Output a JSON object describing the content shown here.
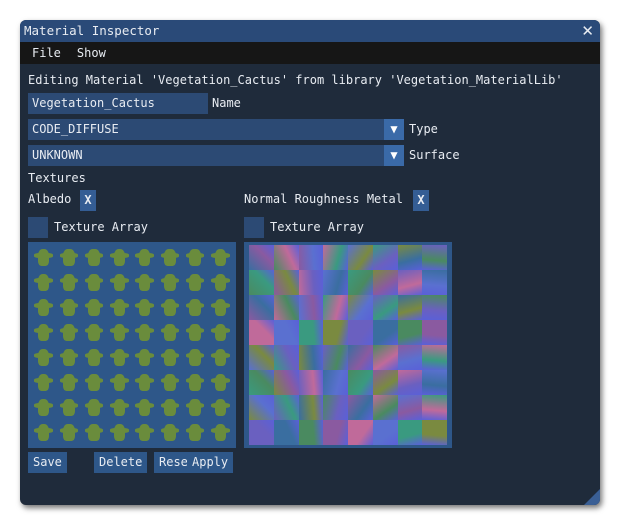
{
  "window": {
    "title": "Material Inspector"
  },
  "menu": [
    "File",
    "Show"
  ],
  "editing_text": "Editing Material 'Vegetation_Cactus' from library 'Vegetation_MaterialLib'",
  "name": {
    "value": "Vegetation_Cactus",
    "label": "Name"
  },
  "type": {
    "value": "CODE_DIFFUSE",
    "label": "Type"
  },
  "surface": {
    "value": "UNKNOWN",
    "label": "Surface"
  },
  "textures": {
    "heading": "Textures",
    "albedo_label": "Albedo",
    "normal_label": "Normal Roughness Metal",
    "clear_label": "X",
    "texture_array_label": "Texture Array"
  },
  "buttons": {
    "save": "Save",
    "delete": "Delete",
    "reset": "Reset",
    "apply": "Apply"
  },
  "colors": {
    "title_bar": "#2a4a78",
    "body": "#1f2b3b",
    "field": "#2c4a74"
  }
}
